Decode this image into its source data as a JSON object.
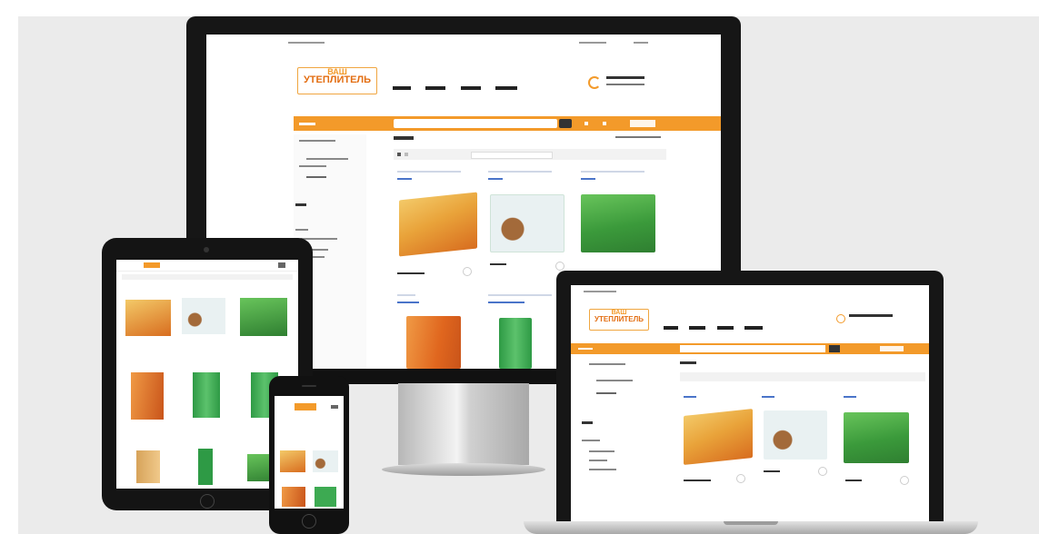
{
  "brand": {
    "logo_top": "ВАШ",
    "logo_bottom": "УТЕПЛИТЕЛЬ",
    "accent": "#f39a2a",
    "accent_dark": "#e36e12"
  },
  "shop": {
    "nav": [
      "",
      "",
      "",
      ""
    ],
    "search_placeholder": "",
    "category_heading": "",
    "filter_label": "",
    "sidebar": [
      "",
      "",
      "",
      ""
    ],
    "products": [
      {
        "color": "#e9b24a",
        "accent": "#e47d28",
        "kind": "slab"
      },
      {
        "color": "#e6eef0",
        "accent": "#2f9f61",
        "kind": "roll"
      },
      {
        "color": "#45a63f",
        "accent": "#7ccd6a",
        "kind": "slab"
      },
      {
        "color": "#ea7a2e",
        "accent": "#f2a250",
        "kind": "slab"
      },
      {
        "color": "#3daa52",
        "accent": "#8bd28a",
        "kind": "tall"
      }
    ]
  },
  "icons": {
    "phone": "phone-icon",
    "search": "search-icon",
    "cart": "cart-icon",
    "home": "home-button-icon"
  }
}
